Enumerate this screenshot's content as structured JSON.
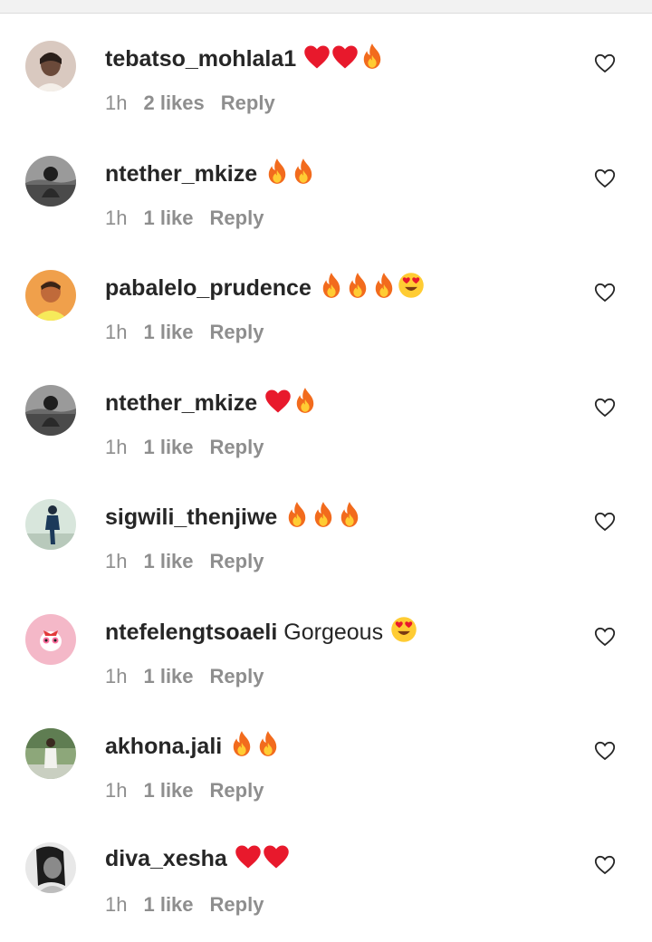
{
  "comments": [
    {
      "username": "tebatso_mohlala1",
      "text": "",
      "emojis": [
        "red-heart",
        "red-heart",
        "fire"
      ],
      "time": "1h",
      "likes": "2 likes",
      "reply": "Reply",
      "avatar": "avatar-woman-light"
    },
    {
      "username": "ntether_mkize",
      "text": "",
      "emojis": [
        "fire",
        "fire"
      ],
      "time": "1h",
      "likes": "1 like",
      "reply": "Reply",
      "avatar": "avatar-grayscale-outdoor"
    },
    {
      "username": "pabalelo_prudence",
      "text": "",
      "emojis": [
        "fire",
        "fire",
        "fire",
        "heart-eyes"
      ],
      "time": "1h",
      "likes": "1 like",
      "reply": "Reply",
      "avatar": "avatar-orange"
    },
    {
      "username": "ntether_mkize",
      "text": "",
      "emojis": [
        "red-heart",
        "fire"
      ],
      "time": "1h",
      "likes": "1 like",
      "reply": "Reply",
      "avatar": "avatar-grayscale-outdoor"
    },
    {
      "username": "sigwili_thenjiwe",
      "text": "",
      "emojis": [
        "fire",
        "fire",
        "fire"
      ],
      "time": "1h",
      "likes": "1 like",
      "reply": "Reply",
      "avatar": "avatar-standing-figure"
    },
    {
      "username": "ntefelengtsoaeli",
      "text": "Gorgeous",
      "emojis": [
        "heart-eyes"
      ],
      "time": "1h",
      "likes": "1 like",
      "reply": "Reply",
      "avatar": "avatar-pink-cartoon"
    },
    {
      "username": "akhona.jali",
      "text": "",
      "emojis": [
        "fire",
        "fire"
      ],
      "time": "1h",
      "likes": "1 like",
      "reply": "Reply",
      "avatar": "avatar-green-outdoor"
    },
    {
      "username": "diva_xesha",
      "text": "",
      "emojis": [
        "red-heart",
        "red-heart"
      ],
      "time": "1h",
      "likes": "1 like",
      "reply": "Reply",
      "avatar": "avatar-grayscale-portrait"
    }
  ],
  "colors": {
    "text_primary": "#262626",
    "text_secondary": "#8e8e8e",
    "heart_red": "#e8192c",
    "fire_orange": "#f26b1d",
    "fire_yellow": "#ffcc33"
  }
}
